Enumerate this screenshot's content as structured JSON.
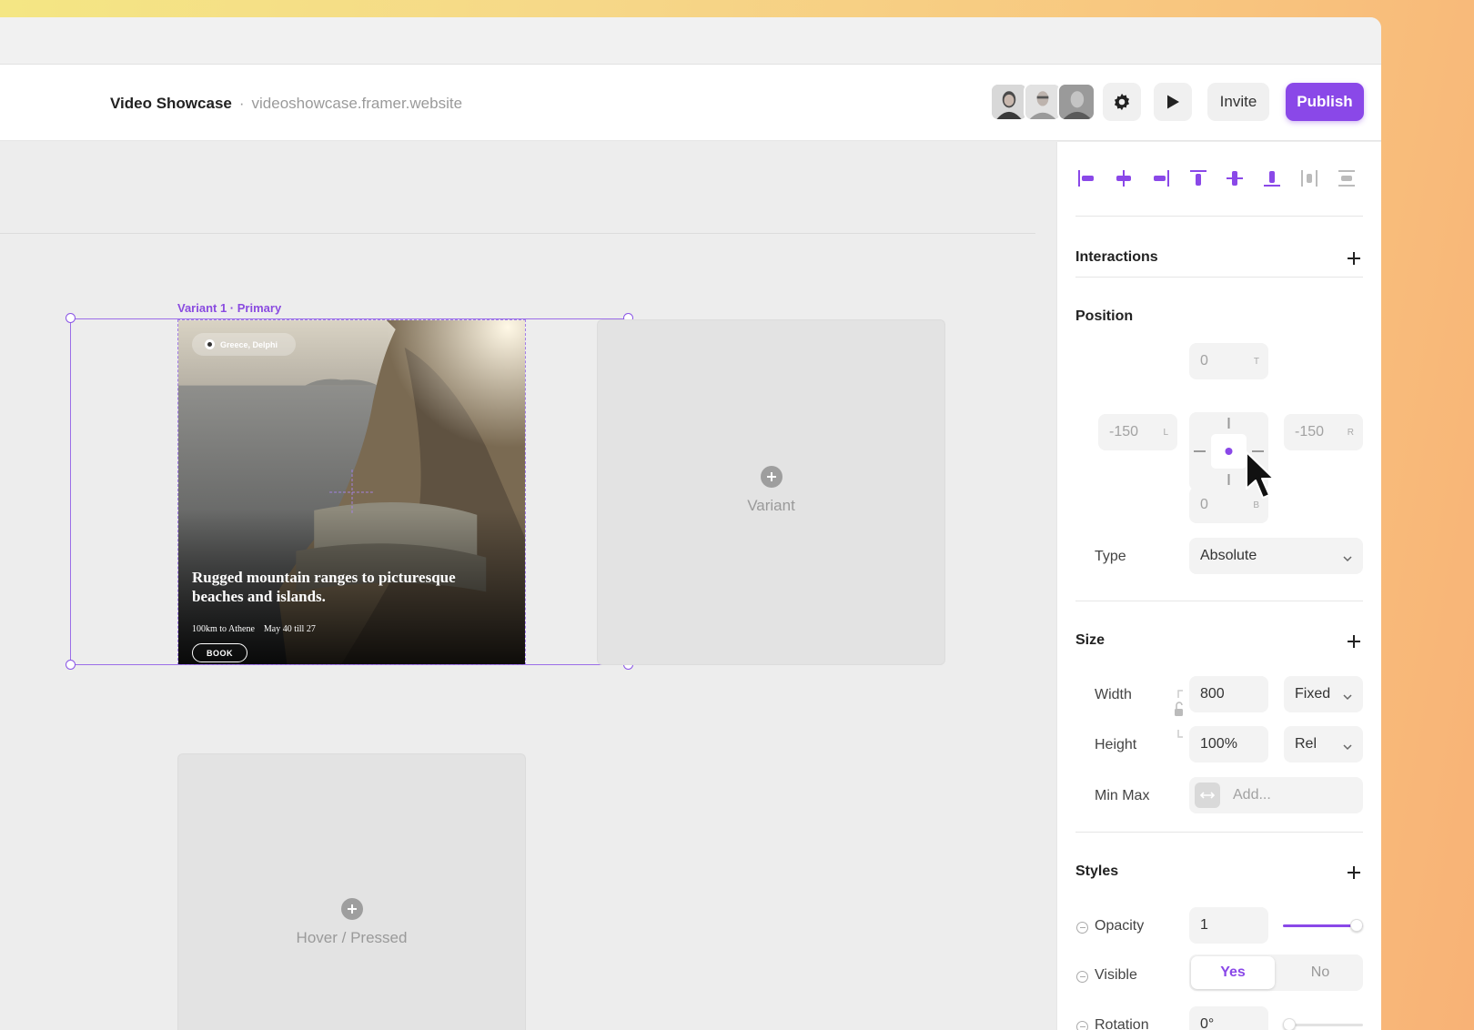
{
  "header": {
    "project_name": "Video Showcase",
    "separator": "·",
    "project_url": "videoshowcase.framer.website",
    "invite_label": "Invite",
    "publish_label": "Publish"
  },
  "canvas": {
    "variant_label": "Variant 1 · Primary",
    "card": {
      "location": "Greece, Delphi",
      "title": "Rugged mountain ranges to picturesque beaches and islands.",
      "distance": "100km to Athene",
      "dates": "May 40 till 27",
      "book_label": "BOOK"
    },
    "add_variant_label": "Variant",
    "add_hover_label": "Hover / Pressed"
  },
  "panel": {
    "interactions": {
      "title": "Interactions"
    },
    "position": {
      "title": "Position",
      "top": {
        "value": "0",
        "suffix": "T"
      },
      "left": {
        "value": "-150",
        "suffix": "L"
      },
      "right": {
        "value": "-150",
        "suffix": "R"
      },
      "bottom": {
        "value": "0",
        "suffix": "B"
      },
      "type_label": "Type",
      "type_value": "Absolute"
    },
    "size": {
      "title": "Size",
      "width_label": "Width",
      "width_value": "800",
      "width_mode": "Fixed",
      "height_label": "Height",
      "height_value": "100%",
      "height_mode": "Rel",
      "minmax_label": "Min Max",
      "minmax_placeholder": "Add..."
    },
    "styles": {
      "title": "Styles",
      "opacity_label": "Opacity",
      "opacity_value": "1",
      "opacity_slider": 1,
      "visible_label": "Visible",
      "visible_yes": "Yes",
      "visible_no": "No",
      "rotation_label": "Rotation",
      "rotation_value": "0°",
      "rotation_slider": 0
    }
  },
  "colors": {
    "accent": "#8a48e8",
    "selection": "#9b6ee8"
  }
}
